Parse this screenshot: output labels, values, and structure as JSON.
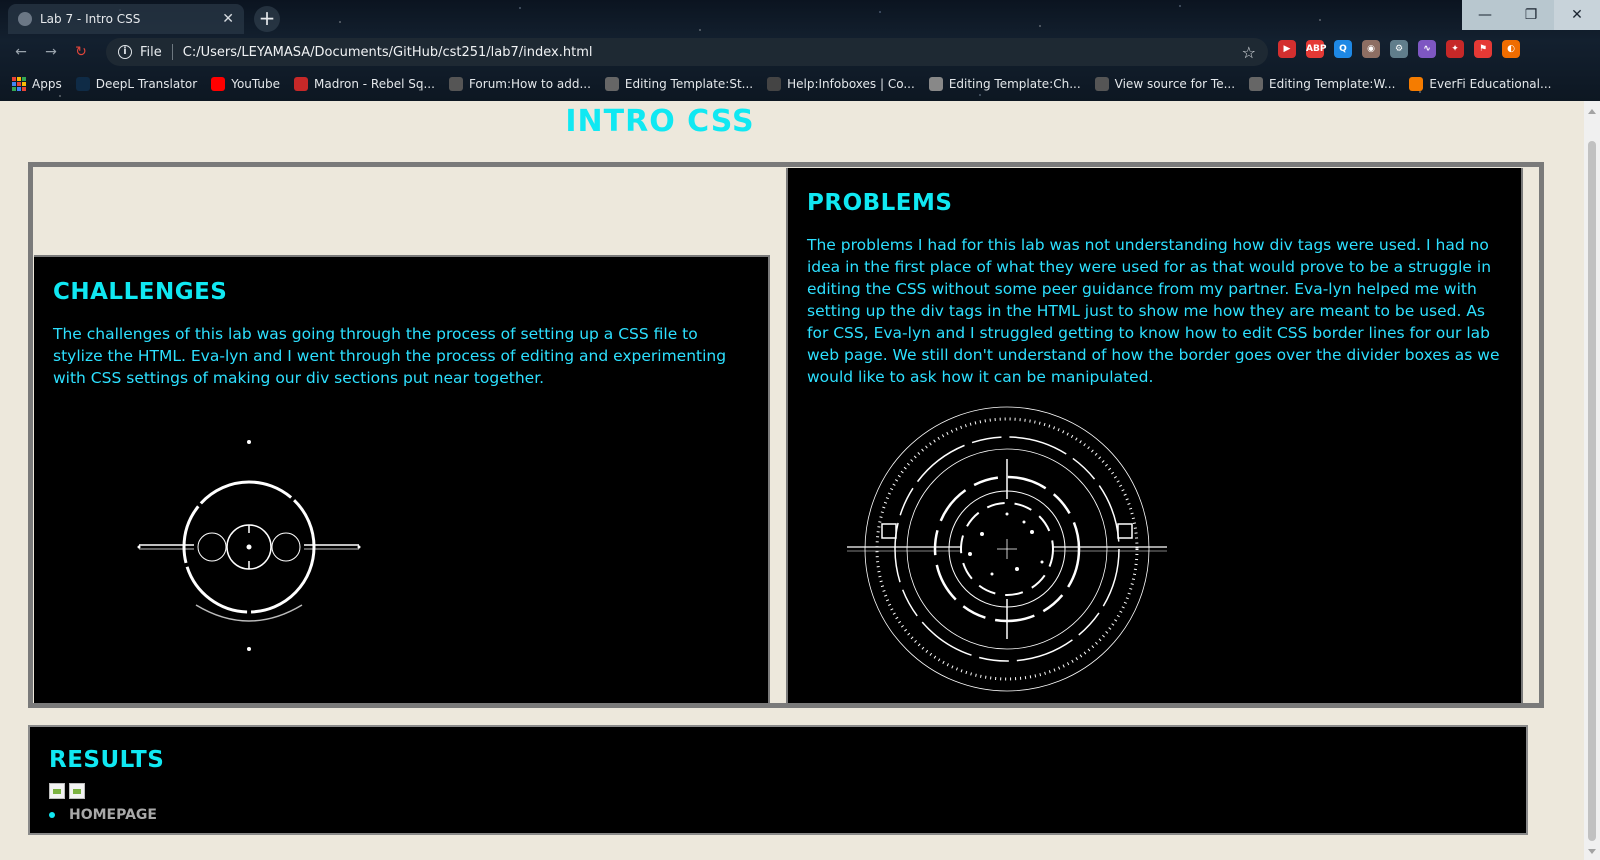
{
  "browser": {
    "tab_title": "Lab 7 - Intro CSS",
    "omnibox_scheme": "File",
    "url": "C:/Users/LEYAMASA/Documents/GitHub/cst251/lab7/index.html",
    "bookmarks": [
      {
        "label": "Apps",
        "color": "#f4b400"
      },
      {
        "label": "DeepL Translator",
        "color": "#0f2b46"
      },
      {
        "label": "YouTube",
        "color": "#ff0000"
      },
      {
        "label": "Madron - Rebel Sq...",
        "color": "#c62828"
      },
      {
        "label": "Forum:How to add...",
        "color": "#555555"
      },
      {
        "label": "Editing Template:St...",
        "color": "#666666"
      },
      {
        "label": "Help:Infoboxes | Co...",
        "color": "#444444"
      },
      {
        "label": "Editing Template:Ch...",
        "color": "#888888"
      },
      {
        "label": "View source for Te...",
        "color": "#555555"
      },
      {
        "label": "Editing Template:W...",
        "color": "#666666"
      },
      {
        "label": "EverFi Educational...",
        "color": "#f57c00"
      }
    ],
    "extensions": [
      {
        "name": "red-extension-icon",
        "color": "#d32f2f",
        "glyph": "▶"
      },
      {
        "name": "adblock-icon",
        "color": "#e53935",
        "glyph": "ABP"
      },
      {
        "name": "search-extension-icon",
        "color": "#1e88e5",
        "glyph": "Q"
      },
      {
        "name": "owl-extension-icon",
        "color": "#8d6e63",
        "glyph": "◉"
      },
      {
        "name": "gear-extension-icon",
        "color": "#607d8b",
        "glyph": "⚙"
      },
      {
        "name": "wave-extension-icon",
        "color": "#7e57c2",
        "glyph": "∿"
      },
      {
        "name": "puzzle-extension-icon",
        "color": "#c62828",
        "glyph": "✦"
      },
      {
        "name": "flag-extension-icon",
        "color": "#e53935",
        "glyph": "⚑"
      },
      {
        "name": "profile-avatar-icon",
        "color": "#ef6c00",
        "glyph": "◐"
      }
    ]
  },
  "page": {
    "title": "INTRO CSS",
    "challenges": {
      "heading": "CHALLENGES",
      "body": "The challenges of this lab was going through the process of setting up a CSS file to stylize the HTML. Eva-lyn and I went through the process of editing and experimenting with CSS settings of making our div sections put near together."
    },
    "problems": {
      "heading": "PROBLEMS",
      "body": "The problems I had for this lab was not understanding how div tags were used. I had no idea in the first place of what they were used for as that would prove to be a struggle in editing the CSS without some peer guidance from my partner. Eva-lyn helped me with setting up the div tags in the HTML just to show me how they are meant to be used. As for CSS, Eva-lyn and I struggled getting to know how to edit CSS border lines for our lab web page. We still don't understand of how the border goes over the divider boxes as we would like to ask how it can be manipulated."
    },
    "results": {
      "heading": "RESULTS",
      "links": [
        "HOMEPAGE"
      ]
    }
  }
}
